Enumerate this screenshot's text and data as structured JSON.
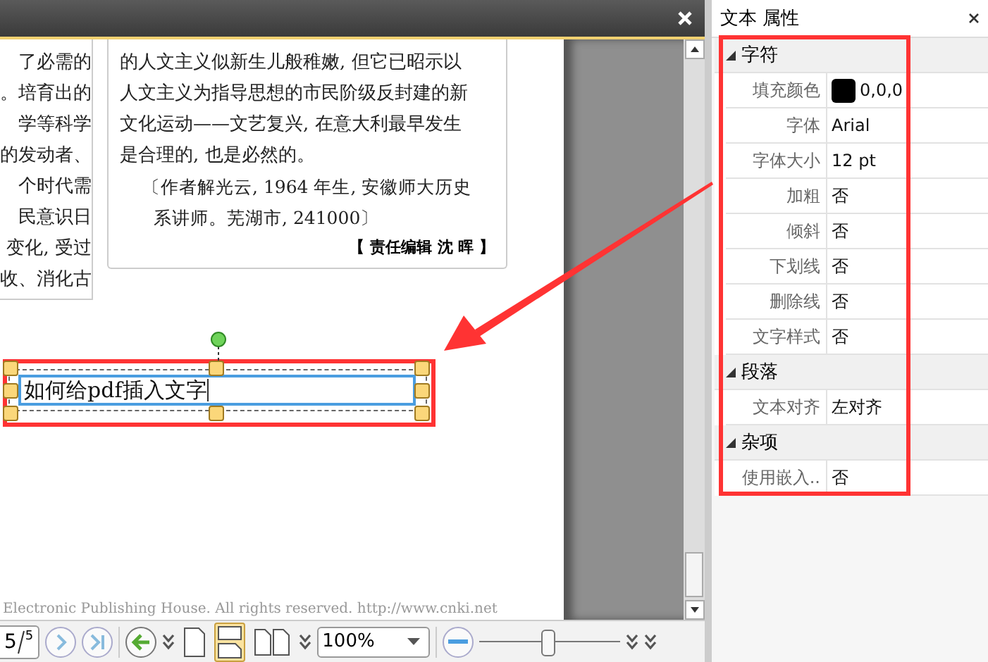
{
  "document": {
    "left_column_lines": [
      "了必需的",
      "。培育出的",
      "学等科学",
      "的发动者、",
      "个时代需",
      "民意识日",
      "变化, 受过",
      "收、消化古"
    ],
    "article_lines": [
      "的人文主义似新生儿般稚嫩, 但它已昭示以",
      "人文主义为指导思想的市民阶级反封建的新",
      "文化运动——文艺复兴, 在意大利最早发生",
      "是合理的, 也是必然的。"
    ],
    "attribution_lines": [
      "〔作者解光云, 1964 年生, 安徽师大历史",
      "系讲师。芜湖市, 241000〕"
    ],
    "editor_credit": "【 责任编辑   沈   晖 】",
    "footer": "Electronic Publishing House. All rights reserved.    http://www.cnki.net"
  },
  "text_box": {
    "value": "如何给pdf插入文字"
  },
  "toolbar": {
    "page": "5",
    "page_count": "5",
    "layout_buttons": [
      {
        "kind": "single",
        "selected": false
      },
      {
        "kind": "continuous",
        "selected": true
      },
      {
        "kind": "two-page",
        "selected": false
      }
    ],
    "zoom": "100%",
    "zoom_slider": {
      "level": 0.49
    }
  },
  "properties_panel": {
    "title": "文本 属性",
    "categories": [
      {
        "name": "字符",
        "expanded": true,
        "rows": [
          {
            "label": "填充颜色",
            "kind": "color",
            "color": "#000000",
            "value": "0,0,0"
          },
          {
            "label": "字体",
            "kind": "text",
            "value": "Arial"
          },
          {
            "label": "字体大小",
            "kind": "text",
            "value": "12 pt"
          },
          {
            "label": "加粗",
            "kind": "text",
            "value": "否"
          },
          {
            "label": "倾斜",
            "kind": "text",
            "value": "否"
          },
          {
            "label": "下划线",
            "kind": "text",
            "value": "否"
          },
          {
            "label": "删除线",
            "kind": "text",
            "value": "否"
          },
          {
            "label": "文字样式",
            "kind": "text",
            "value": "否"
          }
        ]
      },
      {
        "name": "段落",
        "expanded": true,
        "rows": [
          {
            "label": "文本对齐",
            "kind": "text",
            "value": "左对齐"
          }
        ]
      },
      {
        "name": "杂项",
        "expanded": true,
        "rows": [
          {
            "label": "使用嵌入..",
            "kind": "text",
            "value": "否"
          }
        ]
      }
    ]
  }
}
